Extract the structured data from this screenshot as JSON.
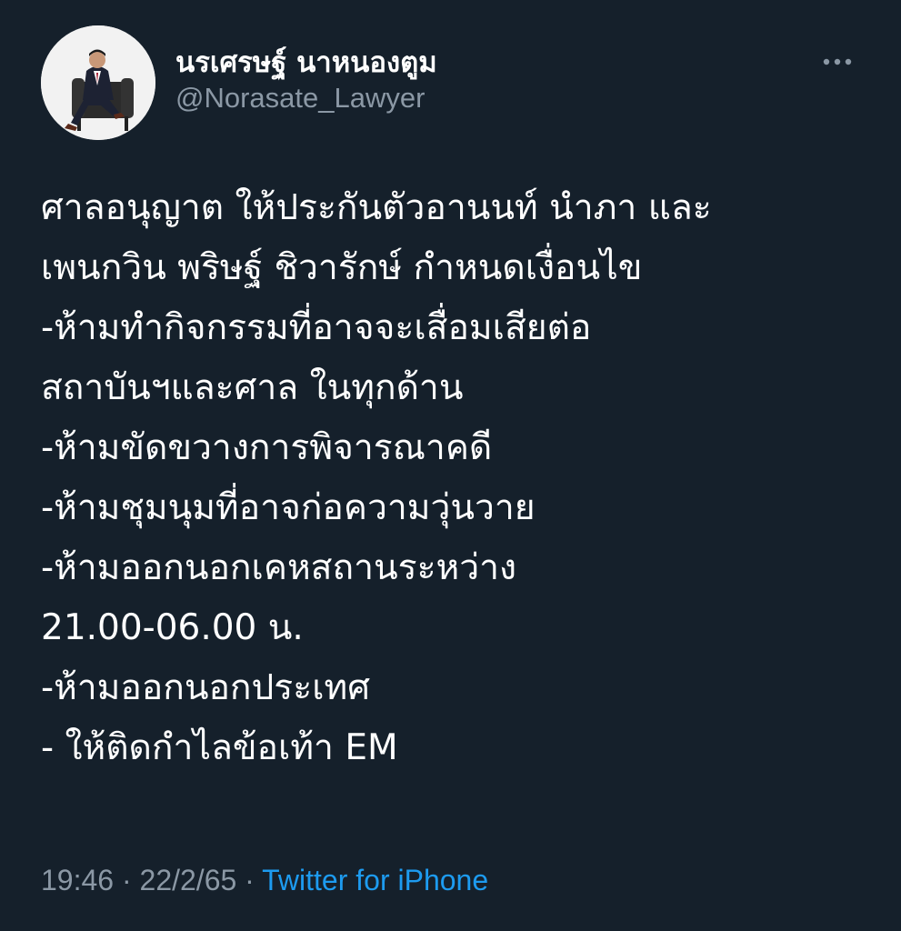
{
  "author": {
    "display_name": "นรเศรษฐ์ นาหนองตูม",
    "handle": "@Norasate_Lawyer",
    "avatar_icon": "profile-photo-man-in-suit-on-chair"
  },
  "more_icon": "more-horizontal-icon",
  "tweet": {
    "lines": [
      "ศาลอนุญาต ให้ประกันตัวอานนท์ นำภา และ",
      "เพนกวิน พริษฐ์ ชิวารักษ์ กำหนดเงื่อนไข",
      "-ห้ามทำกิจกรรมที่อาจจะเสื่อมเสียต่อ",
      "สถาบันฯและศาล ในทุกด้าน",
      "-ห้ามขัดขวางการพิจารณาคดี",
      "-ห้ามชุมนุมที่อาจก่อความวุ่นวาย",
      "-ห้ามออกนอกเคหสถานระหว่าง",
      "21.00-06.00 น.",
      "-ห้ามออกนอกประเทศ",
      "- ให้ติดกำไลข้อเท้า EM"
    ]
  },
  "meta": {
    "time": "19:46",
    "separator": " · ",
    "date": "22/2/65",
    "source": "Twitter for iPhone"
  },
  "colors": {
    "background": "#15202b",
    "text": "#ffffff",
    "secondary": "#8b98a5",
    "link": "#1d9bf0"
  }
}
